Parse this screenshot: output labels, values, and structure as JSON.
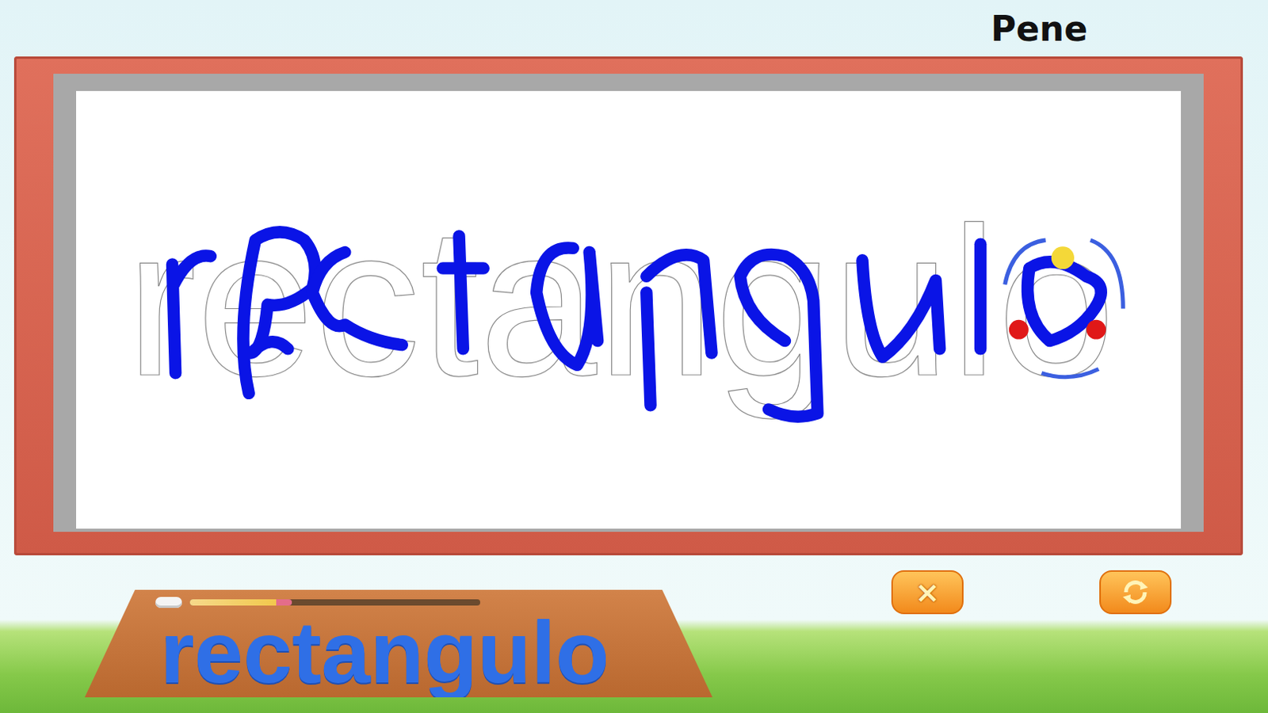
{
  "header": {
    "player_name": "Pene"
  },
  "board": {
    "trace_word": "rectangulo"
  },
  "word_plaque": {
    "word": "rectangulo",
    "progress": {
      "level": 0.35
    }
  },
  "buttons": [
    {
      "kind": "close",
      "label": "×"
    },
    {
      "kind": "repeat"
    }
  ]
}
